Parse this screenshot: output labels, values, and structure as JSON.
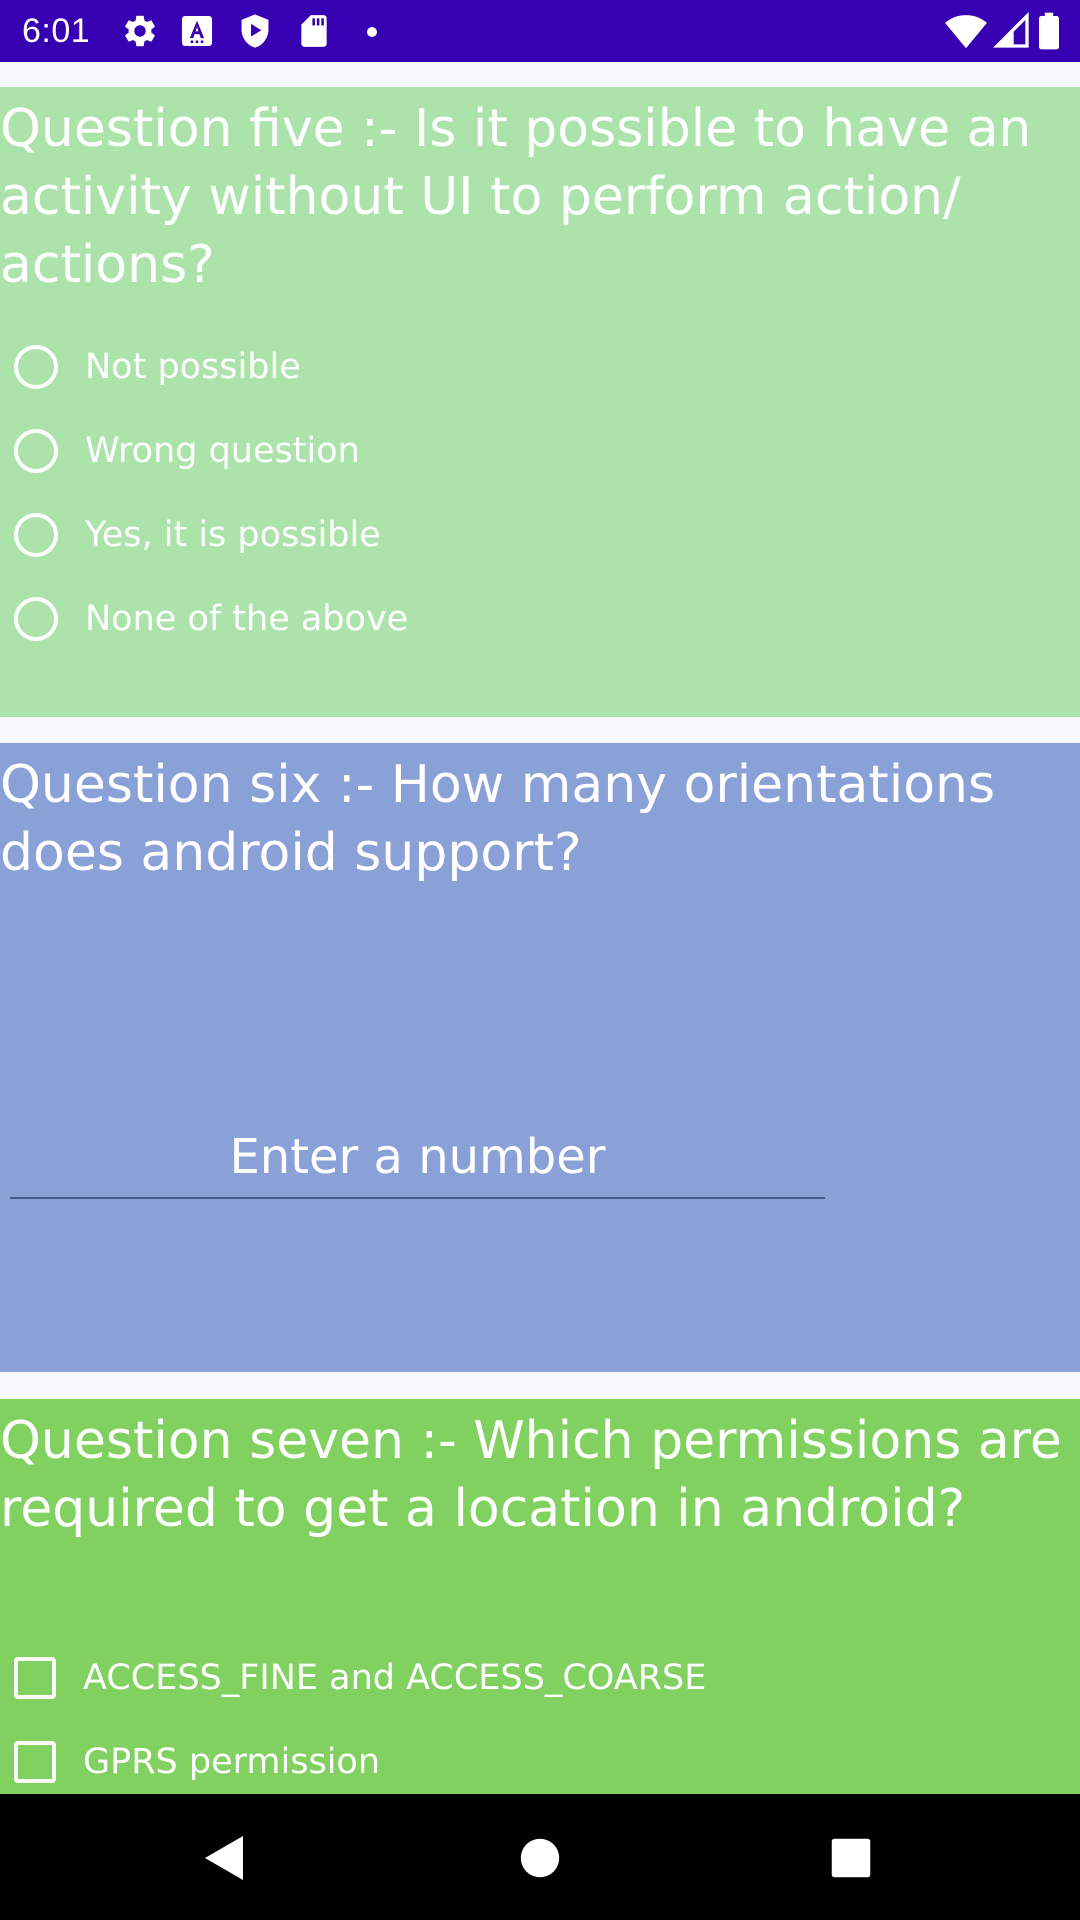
{
  "status_bar": {
    "time": "6:01",
    "icons": [
      "gear-icon",
      "font-a-icon",
      "shield-play-icon",
      "sd-card-icon",
      "notification-dot",
      "wifi-icon",
      "signal-icon",
      "battery-icon"
    ],
    "background": "#3700b3"
  },
  "questions": {
    "q5": {
      "text": "Question five :- Is it possible to have an activity without UI to perform action/ actions?",
      "background": "#abe3ab",
      "options": [
        "Not possible",
        "Wrong question",
        "Yes, it is possible",
        "None of the above"
      ]
    },
    "q6": {
      "text": "Question six :- How many orientations does android support?",
      "background": "#8aa1d7",
      "input_placeholder": "Enter a number",
      "input_value": ""
    },
    "q7": {
      "text": "Question seven :- Which permissions are required to get a location in android?",
      "background": "#81d160",
      "options": [
        "ACCESS_FINE and ACCESS_COARSE",
        "GPRS permission"
      ]
    }
  },
  "nav_bar": {
    "icons": [
      "back-icon",
      "home-icon",
      "recents-icon"
    ]
  }
}
